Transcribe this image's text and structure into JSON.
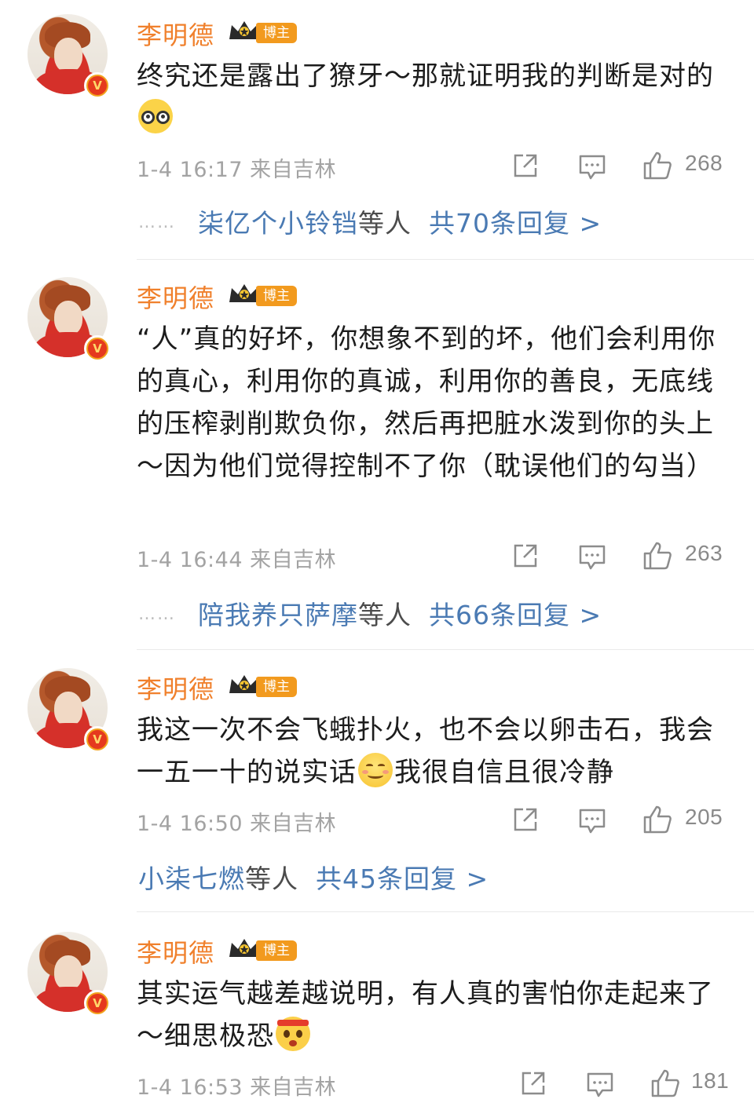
{
  "comments": [
    {
      "username": "李明德",
      "badge": "博主",
      "verified": "V",
      "text_before": "终究还是露出了獠牙～那就证明我的判断是对的",
      "emoji": "glasses-emoji",
      "text_after": "",
      "time": "1-4 16:17",
      "location": "来自吉林",
      "likes": "268",
      "replies": {
        "users": "柒亿个小铃铛",
        "suffix": "等人",
        "total": "共70条回复 >"
      }
    },
    {
      "username": "李明德",
      "badge": "博主",
      "verified": "V",
      "text_before": "“人”真的好坏，你想象不到的坏，他们会利用你的真心，利用你的真诚，利用你的善良，无底线的压榨剥削欺负你，然后再把脏水泼到你的头上～因为他们觉得控制不了你（耽误他们的勾当）",
      "emoji": "",
      "text_after": "",
      "time": "1-4 16:44",
      "location": "来自吉林",
      "likes": "263",
      "replies": {
        "users": "陪我养只萨摩",
        "suffix": "等人",
        "total": "共66条回复 >"
      }
    },
    {
      "username": "李明德",
      "badge": "博主",
      "verified": "V",
      "text_before": "我这一次不会飞蛾扑火，也不会以卵击石，我会一五一十的说实话",
      "emoji": "smile-emoji",
      "text_after": "我很自信且很冷静",
      "time": "1-4 16:50",
      "location": "来自吉林",
      "likes": "205",
      "replies": {
        "users": "小柒七燃",
        "suffix": "等人",
        "total": "共45条回复 >"
      }
    },
    {
      "username": "李明德",
      "badge": "博主",
      "verified": "V",
      "text_before": "其实运气越差越说明，有人真的害怕你走起来了～细思极恐",
      "emoji": "scared-emoji",
      "text_after": "",
      "time": "1-4 16:53",
      "location": "来自吉林",
      "likes": "181"
    }
  ],
  "ellipsis": "……",
  "colors": {
    "username": "#f0802c",
    "link": "#4a7ab3",
    "badge": "#f29a1e",
    "meta": "#a3a3a3"
  }
}
